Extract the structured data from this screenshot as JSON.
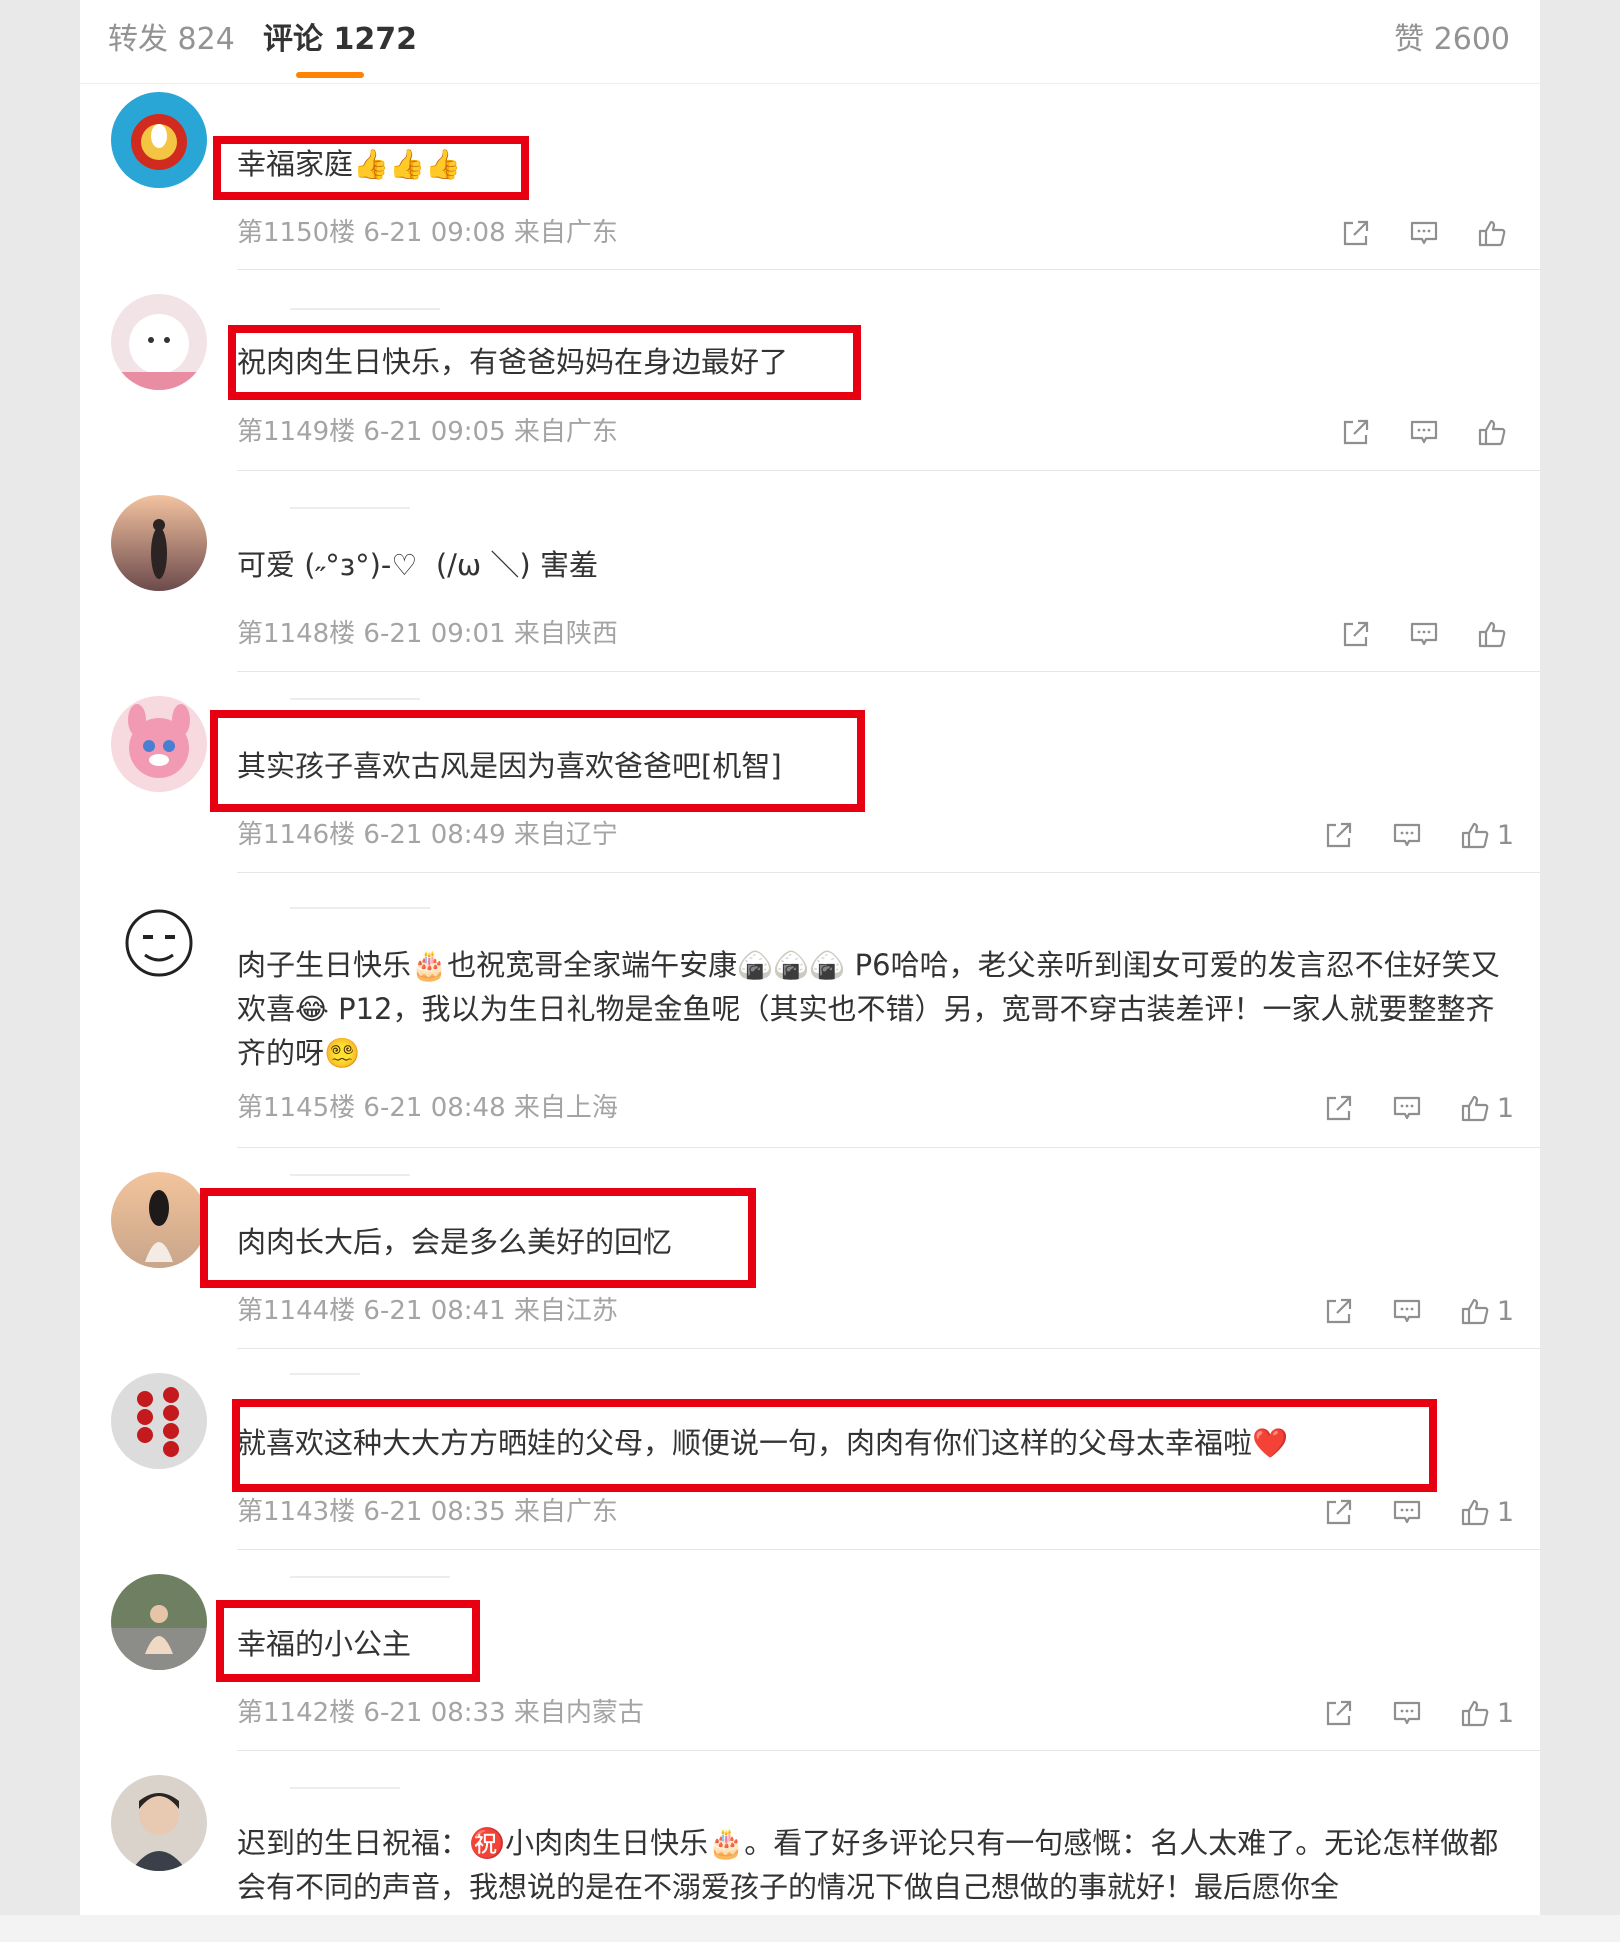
{
  "tabs": {
    "repost": "转发 824",
    "comments": "评论 1272",
    "likes": "赞 2600"
  },
  "icons": {
    "share": "share-icon",
    "reply": "comment-icon",
    "like": "thumbs-up-icon"
  },
  "accent_color": "#ff8200",
  "highlight_color": "#e60012",
  "comments": [
    {
      "text": "幸福家庭👍👍👍",
      "meta": "第1150楼 6-21 09:08 来自广东",
      "likes": ""
    },
    {
      "text": "祝肉肉生日快乐，有爸爸妈妈在身边最好了",
      "meta": "第1149楼 6-21 09:05 来自广东",
      "likes": ""
    },
    {
      "text": "可爱 (˶°з°)-♡  (/ω ＼) 害羞",
      "meta": "第1148楼 6-21 09:01 来自陕西",
      "likes": ""
    },
    {
      "text": "其实孩子喜欢古风是因为喜欢爸爸吧[机智]",
      "meta": "第1146楼 6-21 08:49 来自辽宁",
      "likes": "1"
    },
    {
      "text": "肉子生日快乐🎂也祝宽哥全家端午安康🍙🍙🍙 P6哈哈，老父亲听到闺女可爱的发言忍不住好笑又欢喜😂 P12，我以为生日礼物是金鱼呢（其实也不错）另，宽哥不穿古装差评！一家人就要整整齐齐的呀😵‍💫",
      "meta": "第1145楼 6-21 08:48 来自上海",
      "likes": "1"
    },
    {
      "text": "肉肉长大后，会是多么美好的回忆",
      "meta": "第1144楼 6-21 08:41 来自江苏",
      "likes": "1"
    },
    {
      "text": "就喜欢这种大大方方晒娃的父母，顺便说一句，肉肉有你们这样的父母太幸福啦❤️",
      "meta": "第1143楼 6-21 08:35 来自广东",
      "likes": "1"
    },
    {
      "text": "幸福的小公主",
      "meta": "第1142楼 6-21 08:33 来自内蒙古",
      "likes": "1"
    },
    {
      "text": "迟到的生日祝福：㊗️小肉肉生日快乐🎂。看了好多评论只有一句感慨：名人太难了。无论怎样做都会有不同的声音，我想说的是在不溺爱孩子的情况下做自己想做的事就好！最后愿你全",
      "meta": "",
      "likes": ""
    }
  ]
}
